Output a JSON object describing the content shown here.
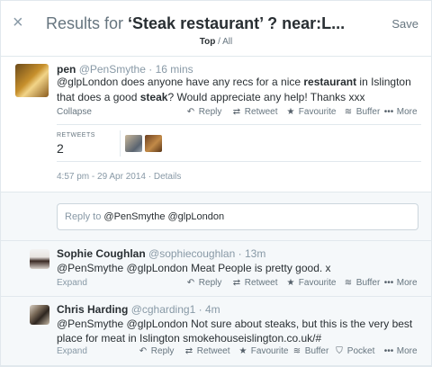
{
  "header": {
    "close_icon": "×",
    "title_prefix": "Results for ",
    "title_query": "‘Steak restaurant’ ? near:L...",
    "save": "Save",
    "filter_active": "Top",
    "filter_sep": " / ",
    "filter_other": "All"
  },
  "main_tweet": {
    "name": "pen",
    "handle": "@PenSmythe",
    "time": "16 mins",
    "text_parts": {
      "p1": "@glpLondon does anyone have any recs for a nice ",
      "b1": "restaurant",
      "p2": " in Islington that does a good ",
      "b2": "steak",
      "p3": "? Would appreciate any help! Thanks xxx"
    },
    "collapse": "Collapse",
    "actions": {
      "reply": "Reply",
      "retweet": "Retweet",
      "favourite": "Favourite",
      "buffer": "Buffer",
      "more": "More"
    },
    "retweets_label": "RETWEETS",
    "retweets_count": "2",
    "timestamp": "4:57 pm - 29 Apr 2014 · Details"
  },
  "reply_box": {
    "prefix": "Reply to ",
    "mentions": "@PenSmythe @glpLondon"
  },
  "replies": [
    {
      "name": "Sophie Coughlan",
      "handle": "@sophiecoughlan",
      "time": "13m",
      "text": "@PenSmythe @glpLondon Meat People is pretty good. x",
      "expand": "Expand",
      "actions": {
        "reply": "Reply",
        "retweet": "Retweet",
        "favourite": "Favourite",
        "buffer": "Buffer",
        "more": "More"
      }
    },
    {
      "name": "Chris Harding",
      "handle": "@cgharding1",
      "time": "4m",
      "text": "@PenSmythe @glpLondon Not sure about steaks, but this is the very best place for meat in Islington smokehouseislington.co.uk/#",
      "expand": "Expand",
      "actions": {
        "reply": "Reply",
        "retweet": "Retweet",
        "favourite": "Favourite",
        "buffer": "Buffer",
        "pocket": "Pocket",
        "more": "More"
      }
    }
  ],
  "icons": {
    "reply": "reply-arrow-icon",
    "retweet": "retweet-icon",
    "favourite": "star-icon",
    "buffer": "buffer-stack-icon",
    "pocket": "pocket-icon",
    "more": "more-dots-icon"
  },
  "colors": {
    "text": "#292f33",
    "muted": "#8899a6",
    "border": "#e1e8ed",
    "reply_bg": "#f5f8fa"
  }
}
